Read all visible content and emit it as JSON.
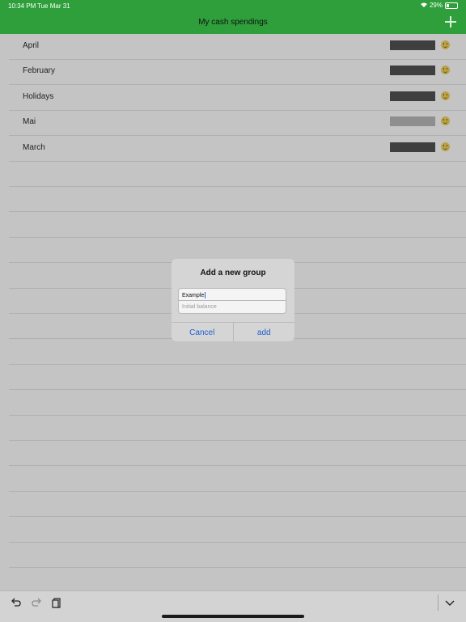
{
  "status": {
    "time": "10:34 PM",
    "date": "Tue Mar 31",
    "battery": "29%",
    "battery_level": 0.29
  },
  "nav": {
    "title": "My cash spendings"
  },
  "groups": [
    {
      "name": "April"
    },
    {
      "name": "February"
    },
    {
      "name": "Holidays"
    },
    {
      "name": "Mai"
    },
    {
      "name": "March"
    }
  ],
  "dialog": {
    "title": "Add a new group",
    "name_value": "Example",
    "balance_placeholder": "Initial balance",
    "cancel_label": "Cancel",
    "add_label": "add"
  },
  "toolbar": {
    "undo_icon": "undo-icon",
    "redo_icon": "redo-icon",
    "paste_icon": "paste-icon",
    "dismiss_icon": "chevron-down-icon"
  },
  "colors": {
    "accent": "#2e9f3b",
    "link": "#1e5fd1"
  }
}
